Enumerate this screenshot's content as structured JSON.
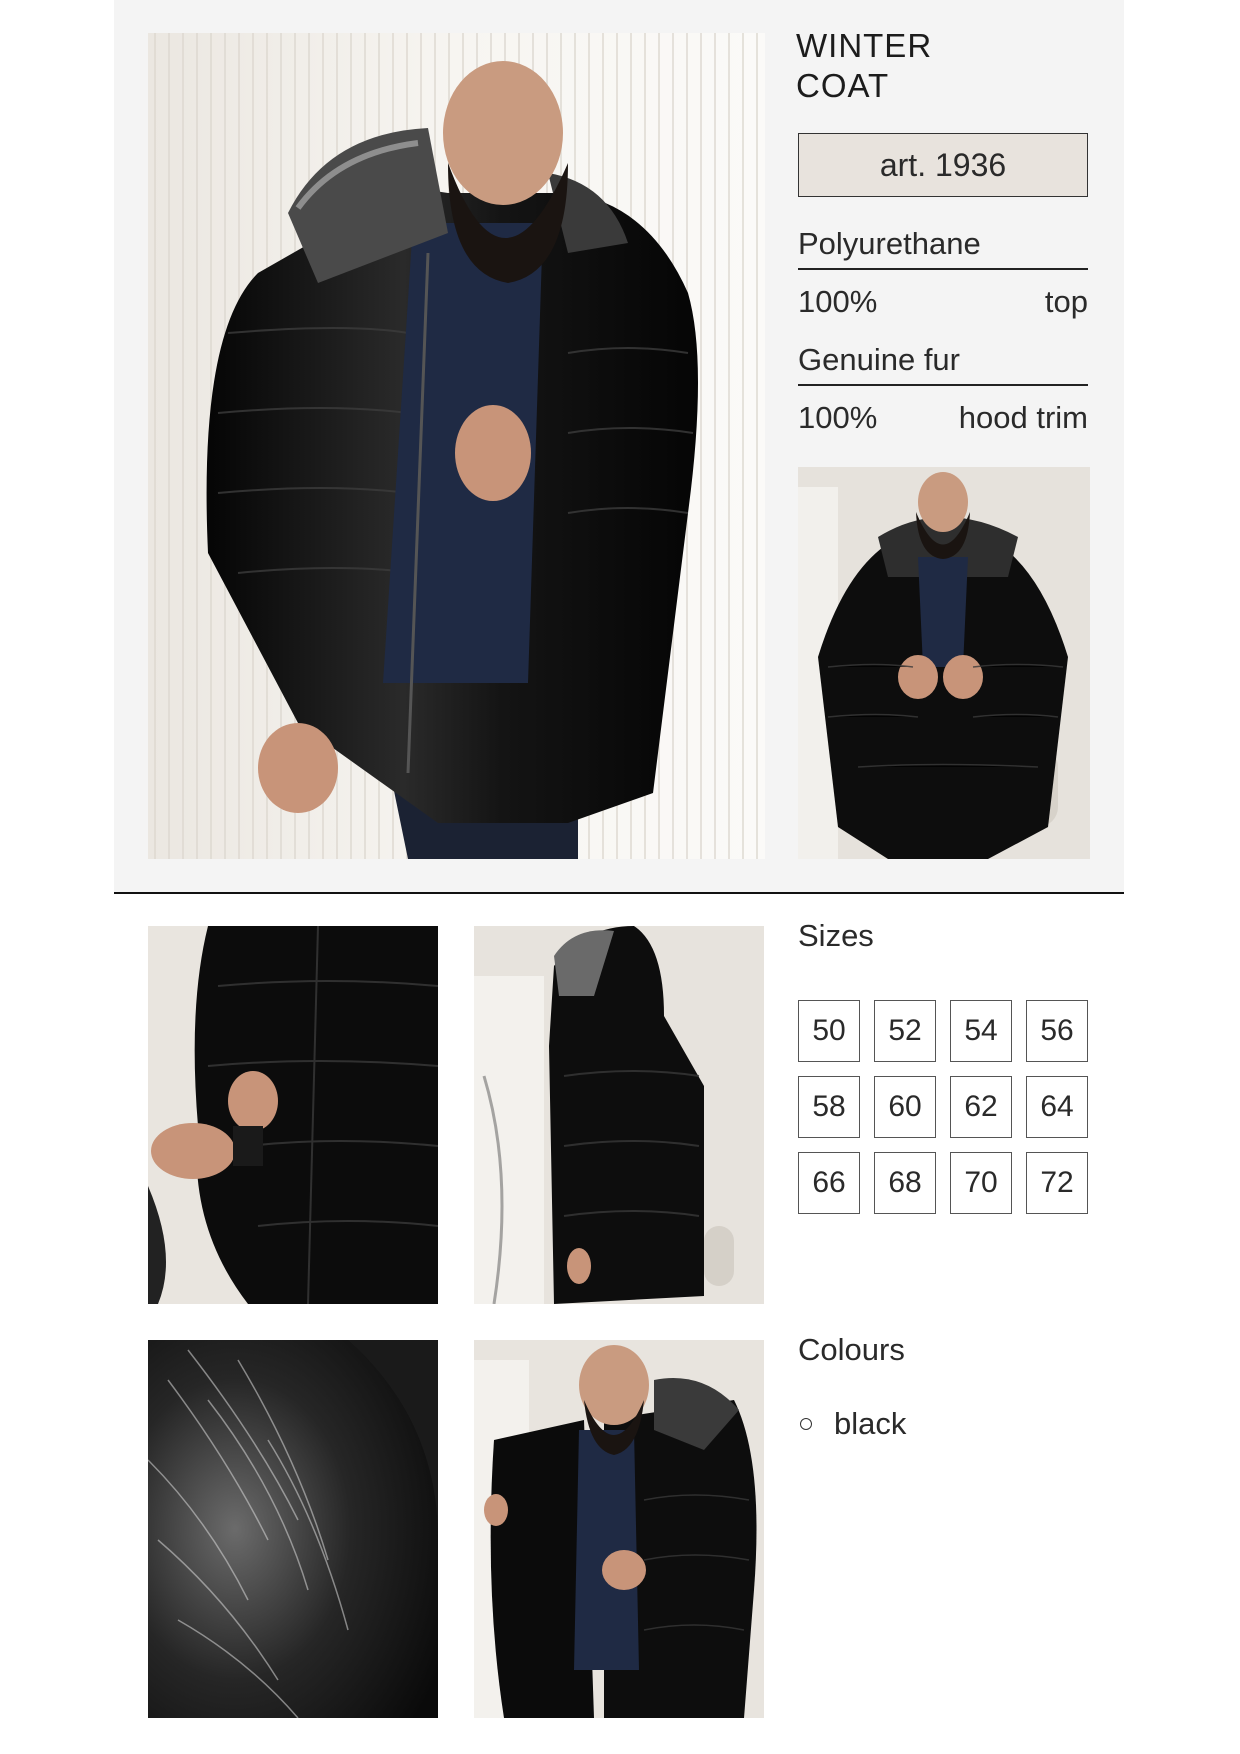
{
  "product": {
    "title_line1": "WINTER",
    "title_line2": "COAT",
    "article": "art. 1936"
  },
  "materials": [
    {
      "name": "Polyurethane",
      "percent": "100%",
      "part": "top"
    },
    {
      "name": "Genuine fur",
      "percent": "100%",
      "part": "hood trim"
    }
  ],
  "sizes": {
    "heading": "Sizes",
    "values": [
      "50",
      "52",
      "54",
      "56",
      "58",
      "60",
      "62",
      "64",
      "66",
      "68",
      "70",
      "72"
    ]
  },
  "colours": {
    "heading": "Colours",
    "items": [
      "black"
    ]
  },
  "colors": {
    "panel_background": "#f4f4f4",
    "article_box": "#e8e3dd",
    "coat": "#111111",
    "shirt": "#1f2a44"
  },
  "images": [
    "main-photo-icon",
    "front-thumbnail-icon",
    "sleeve-detail-icon",
    "side-view-icon",
    "fur-detail-icon",
    "lining-view-icon"
  ]
}
